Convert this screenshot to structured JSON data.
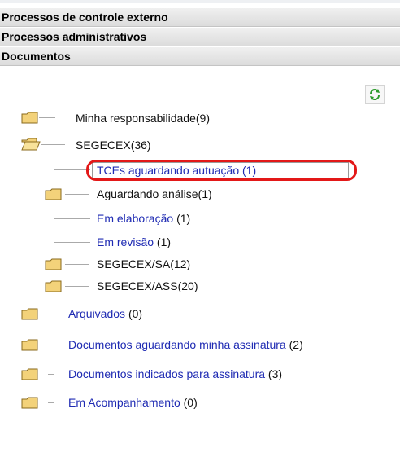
{
  "sections": [
    {
      "label": "Processos de controle externo"
    },
    {
      "label": "Processos administrativos"
    },
    {
      "label": "Documentos"
    }
  ],
  "refresh": {
    "icon": "refresh-icon"
  },
  "tree": {
    "minha": {
      "label": "Minha responsabilidade(9)"
    },
    "segecex": {
      "label": "SEGECEX(36)"
    },
    "tces": {
      "label": "TCEs aguardando autuação (1)"
    },
    "aguardando": {
      "label": "Aguardando análise(1)"
    },
    "elaboracao": {
      "label": "Em elaboração",
      "count": "(1)"
    },
    "revisao": {
      "label": "Em revisão",
      "count": "(1)"
    },
    "sa": {
      "label": "SEGECEX/SA(12)"
    },
    "ass": {
      "label": "SEGECEX/ASS(20)"
    },
    "arquivados": {
      "label": "Arquivados",
      "count": "(0)"
    },
    "docs_minha": {
      "label": "Documentos aguardando minha assinatura",
      "count": "(2)"
    },
    "docs_indicados": {
      "label": "Documentos indicados para assinatura",
      "count": "(3)"
    },
    "acompanhamento": {
      "label": "Em Acompanhamento",
      "count": "(0)"
    }
  },
  "colors": {
    "link": "#1f2bb3",
    "highlight": "#e31818",
    "folder": "#f3d27a"
  }
}
